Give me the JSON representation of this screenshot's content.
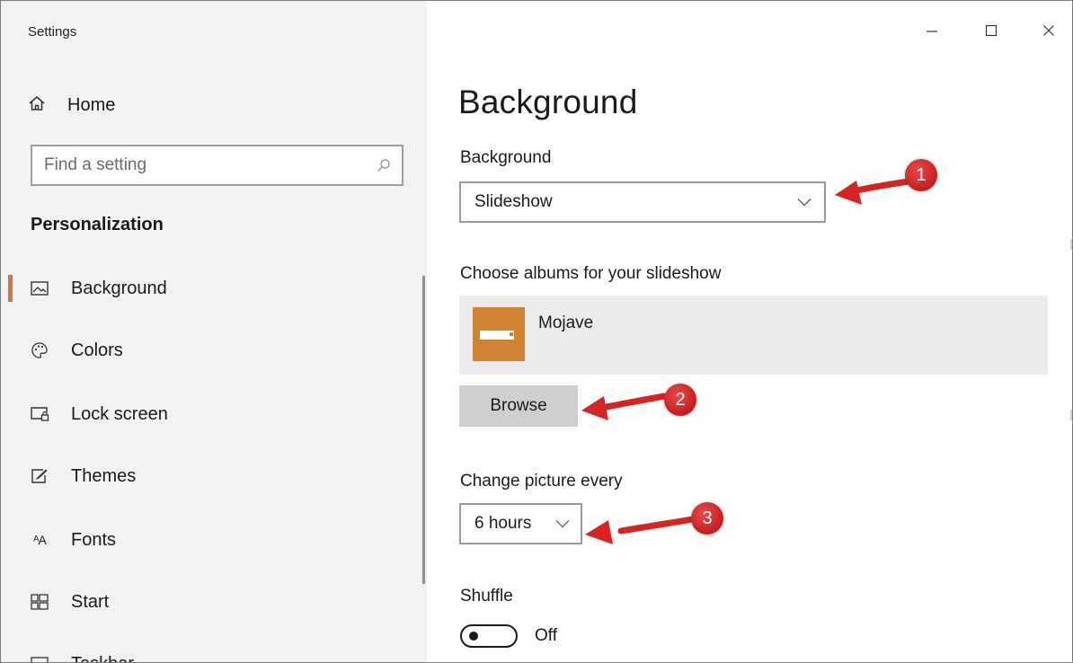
{
  "window": {
    "title": "Settings",
    "controls": [
      "minimize",
      "maximize",
      "close"
    ]
  },
  "sidebar": {
    "home_label": "Home",
    "search_placeholder": "Find a setting",
    "section_title": "Personalization",
    "items": [
      {
        "label": "Background",
        "icon": "picture-icon",
        "active": true
      },
      {
        "label": "Colors",
        "icon": "palette-icon",
        "active": false
      },
      {
        "label": "Lock screen",
        "icon": "lock-screen-icon",
        "active": false
      },
      {
        "label": "Themes",
        "icon": "themes-icon",
        "active": false
      },
      {
        "label": "Fonts",
        "icon": "fonts-icon",
        "active": false
      },
      {
        "label": "Start",
        "icon": "start-icon",
        "active": false
      },
      {
        "label": "Taskbar",
        "icon": "taskbar-icon",
        "active": false
      }
    ],
    "fonts_icon_glyph": "ᴬA"
  },
  "main": {
    "page_title": "Background",
    "background_label": "Background",
    "background_value": "Slideshow",
    "albums_label": "Choose albums for your slideshow",
    "album_name": "Mojave",
    "browse_label": "Browse",
    "change_label": "Change picture every",
    "change_value": "6 hours",
    "shuffle_label": "Shuffle",
    "shuffle_state": "Off"
  },
  "annotations": {
    "callouts": [
      "1",
      "2",
      "3"
    ],
    "color": "#d62424"
  },
  "colors": {
    "accent": "#c77a4a",
    "album_thumb": "#d18233",
    "sidebar_bg": "#f2f2f2"
  }
}
